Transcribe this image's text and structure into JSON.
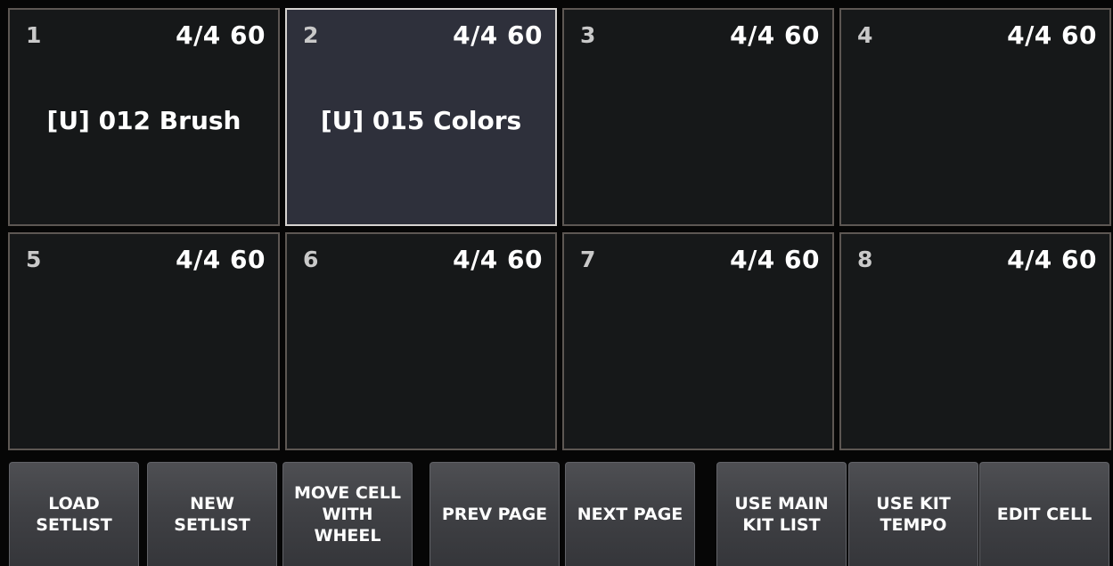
{
  "cells": [
    {
      "number": "1",
      "meta": "4/4 60",
      "kit": "[U] 012 Brush",
      "selected": false
    },
    {
      "number": "2",
      "meta": "4/4 60",
      "kit": "[U] 015 Colors",
      "selected": true
    },
    {
      "number": "3",
      "meta": "4/4 60",
      "kit": "",
      "selected": false
    },
    {
      "number": "4",
      "meta": "4/4 60",
      "kit": "",
      "selected": false
    },
    {
      "number": "5",
      "meta": "4/4 60",
      "kit": "",
      "selected": false
    },
    {
      "number": "6",
      "meta": "4/4 60",
      "kit": "",
      "selected": false
    },
    {
      "number": "7",
      "meta": "4/4 60",
      "kit": "",
      "selected": false
    },
    {
      "number": "8",
      "meta": "4/4 60",
      "kit": "",
      "selected": false
    }
  ],
  "buttons": [
    {
      "label": "LOAD\nSETLIST"
    },
    {
      "label": "NEW\nSETLIST"
    },
    {
      "label": "MOVE CELL\nWITH\nWHEEL"
    },
    {
      "label": "PREV PAGE"
    },
    {
      "label": "NEXT PAGE"
    },
    {
      "label": "USE MAIN\nKIT LIST"
    },
    {
      "label": "USE KIT\nTEMPO"
    },
    {
      "label": "EDIT CELL"
    }
  ],
  "colors": {
    "cell_background": "#161819",
    "cell_selected_background": "#2e303b",
    "cell_border": "#5d5753",
    "cell_selected_border": "#d6d3d0",
    "button_background": "#434448"
  }
}
